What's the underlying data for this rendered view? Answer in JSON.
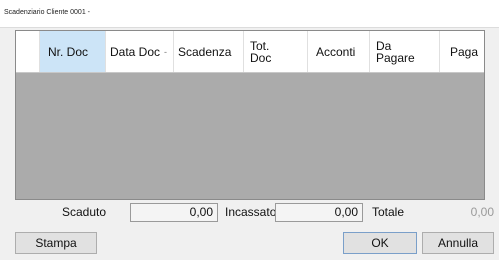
{
  "window": {
    "title": "Scadenziario Cliente 0001 -"
  },
  "grid": {
    "columns": [
      {
        "label": "Nr. Doc",
        "selected": true
      },
      {
        "label": "Data Doc",
        "sort_indicator": "-"
      },
      {
        "label": "Scadenza"
      },
      {
        "label": "Tot.\nDoc"
      },
      {
        "label": "Acconti"
      },
      {
        "label": "Da\nPagare"
      },
      {
        "label": "Paga"
      }
    ],
    "rows": []
  },
  "summary": {
    "scaduto_label": "Scaduto",
    "scaduto_value": "0,00",
    "incassato_label": "Incassato",
    "incassato_value": "0,00",
    "totale_label": "Totale",
    "totale_value": "0,00"
  },
  "buttons": {
    "stampa": "Stampa",
    "ok": "OK",
    "annulla": "Annulla"
  },
  "colors": {
    "grid_background": "#ababab",
    "selected_header": "#cce4f7",
    "window_background": "#f0f0f0"
  }
}
